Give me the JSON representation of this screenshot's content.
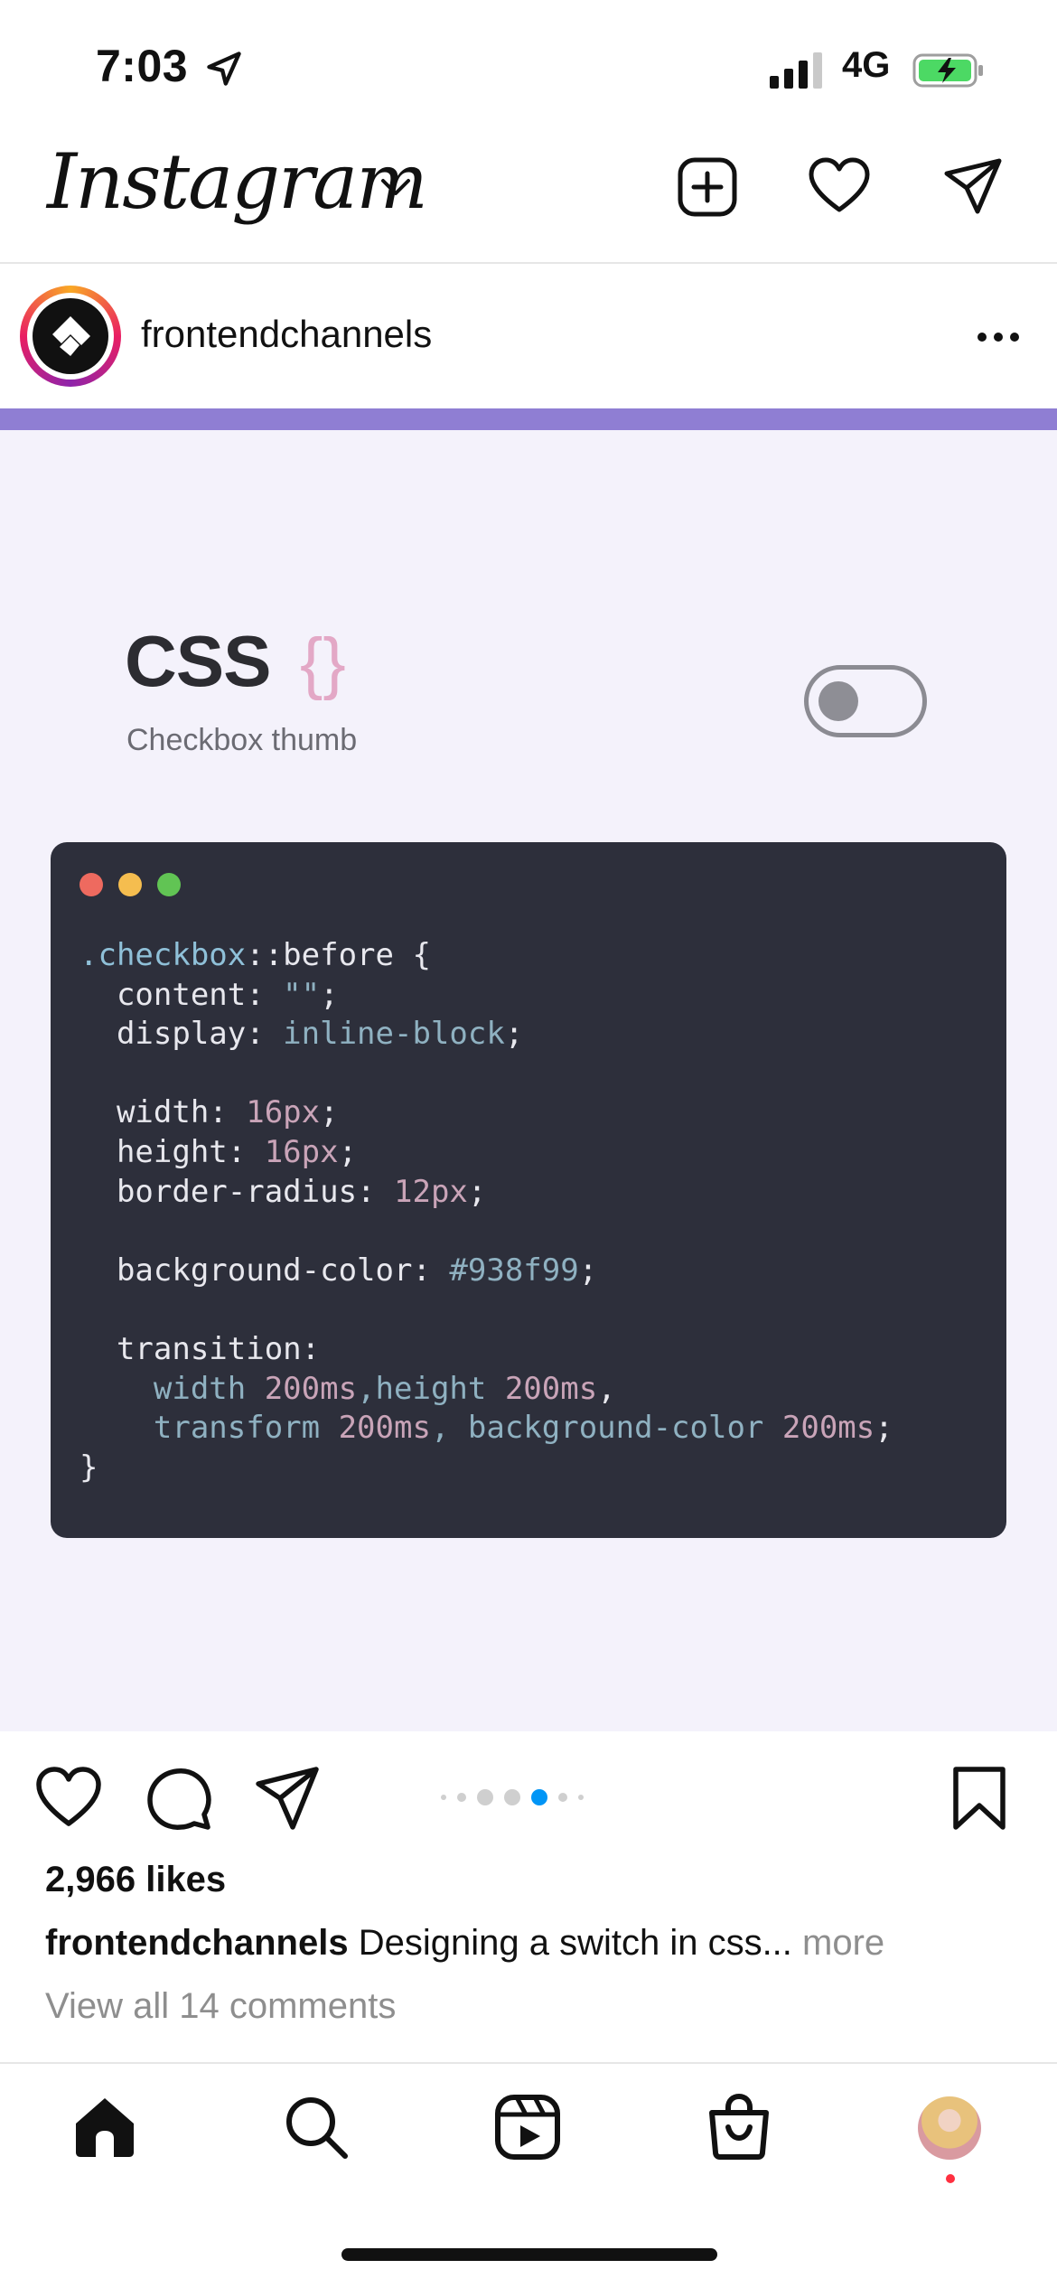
{
  "status_bar": {
    "time": "7:03",
    "network": "4G"
  },
  "header": {
    "logo": "Instagram"
  },
  "post": {
    "author": "frontendchannels",
    "image": {
      "title": "CSS",
      "braces": "{}",
      "subtitle": "Checkbox thumb",
      "code": {
        "line1_selector": ".checkbox",
        "line1_rest": "::before {",
        "line2_prop": "  content: ",
        "line2_val": "\"\"",
        "line2_end": ";",
        "line3_prop": "  display: ",
        "line3_val": "inline-block",
        "line3_end": ";",
        "line5_prop": "  width: ",
        "line5_val": "16px",
        "line5_end": ";",
        "line6_prop": "  height: ",
        "line6_val": "16px",
        "line6_end": ";",
        "line7_prop": "  border-radius: ",
        "line7_val": "12px",
        "line7_end": ";",
        "line9_prop": "  background-color: ",
        "line9_val": "#938f99",
        "line9_end": ";",
        "line11": "  transition:",
        "line12_a": "    width ",
        "line12_b": "200ms",
        "line12_c": ",height ",
        "line12_d": "200ms",
        "line12_e": ",",
        "line13_a": "    transform ",
        "line13_b": "200ms",
        "line13_c": ", background-color ",
        "line13_d": "200ms",
        "line13_e": ";",
        "line14": "}"
      }
    },
    "carousel": {
      "active_index": 3,
      "count": 6
    },
    "likes": "2,966 likes",
    "caption_author": "frontendchannels",
    "caption_text": " Designing a switch in css... ",
    "caption_more": "more",
    "view_comments": "View all 14 comments"
  },
  "colors": {
    "accent_blue": "#0095f6",
    "band_purple": "#8f7ed3",
    "code_bg": "#2d2f3b",
    "notification": "#ff3040"
  },
  "icons": {
    "header": [
      "create-post-icon",
      "heart-icon",
      "direct-message-icon"
    ],
    "actions": [
      "like-icon",
      "comment-icon",
      "share-icon",
      "save-icon"
    ],
    "tabs": [
      "home-icon",
      "search-icon",
      "reels-icon",
      "shop-icon",
      "profile-avatar"
    ]
  }
}
